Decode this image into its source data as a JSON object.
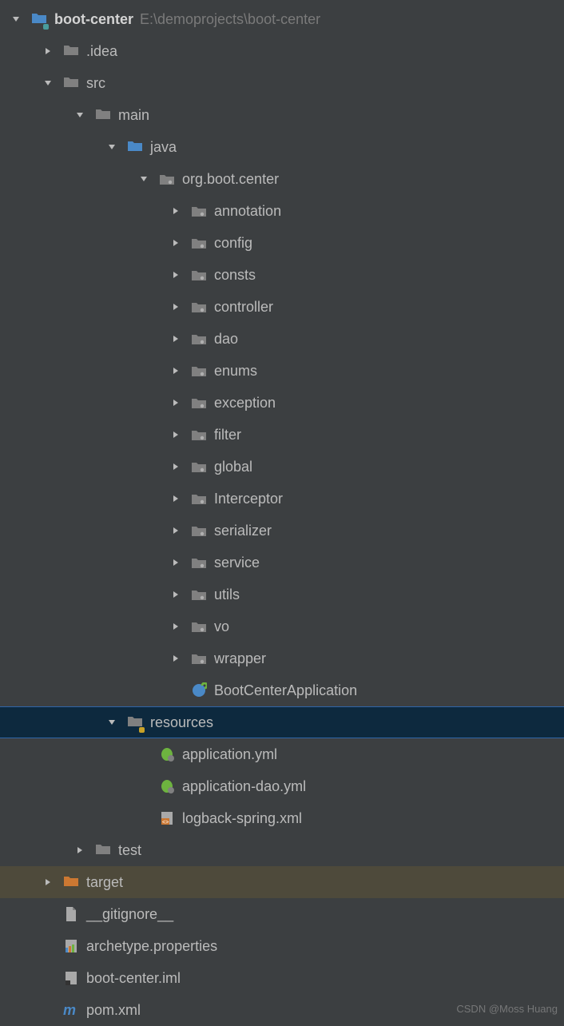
{
  "root": {
    "name": "boot-center",
    "path": "E:\\demoprojects\\boot-center"
  },
  "tree": [
    {
      "depth": 0,
      "expand": "open",
      "icon": "module-folder",
      "label": "boot-center",
      "bold": true,
      "aux": "E:\\demoprojects\\boot-center"
    },
    {
      "depth": 1,
      "expand": "closed",
      "icon": "folder",
      "label": ".idea"
    },
    {
      "depth": 1,
      "expand": "open",
      "icon": "folder",
      "label": "src"
    },
    {
      "depth": 2,
      "expand": "open",
      "icon": "folder",
      "label": "main"
    },
    {
      "depth": 3,
      "expand": "open",
      "icon": "folder-source",
      "label": "java"
    },
    {
      "depth": 4,
      "expand": "open",
      "icon": "package",
      "label": "org.boot.center"
    },
    {
      "depth": 5,
      "expand": "closed",
      "icon": "package",
      "label": "annotation"
    },
    {
      "depth": 5,
      "expand": "closed",
      "icon": "package",
      "label": "config"
    },
    {
      "depth": 5,
      "expand": "closed",
      "icon": "package",
      "label": "consts"
    },
    {
      "depth": 5,
      "expand": "closed",
      "icon": "package",
      "label": "controller"
    },
    {
      "depth": 5,
      "expand": "closed",
      "icon": "package",
      "label": "dao"
    },
    {
      "depth": 5,
      "expand": "closed",
      "icon": "package",
      "label": "enums"
    },
    {
      "depth": 5,
      "expand": "closed",
      "icon": "package",
      "label": "exception"
    },
    {
      "depth": 5,
      "expand": "closed",
      "icon": "package",
      "label": "filter"
    },
    {
      "depth": 5,
      "expand": "closed",
      "icon": "package",
      "label": "global"
    },
    {
      "depth": 5,
      "expand": "closed",
      "icon": "package",
      "label": "Interceptor"
    },
    {
      "depth": 5,
      "expand": "closed",
      "icon": "package",
      "label": "serializer"
    },
    {
      "depth": 5,
      "expand": "closed",
      "icon": "package",
      "label": "service"
    },
    {
      "depth": 5,
      "expand": "closed",
      "icon": "package",
      "label": "utils"
    },
    {
      "depth": 5,
      "expand": "closed",
      "icon": "package",
      "label": "vo"
    },
    {
      "depth": 5,
      "expand": "closed",
      "icon": "package",
      "label": "wrapper"
    },
    {
      "depth": 5,
      "expand": "none",
      "icon": "spring-run",
      "label": "BootCenterApplication"
    },
    {
      "depth": 3,
      "expand": "open",
      "icon": "folder-res",
      "label": "resources",
      "selected": true
    },
    {
      "depth": 4,
      "expand": "none",
      "icon": "spring-yml",
      "label": "application.yml"
    },
    {
      "depth": 4,
      "expand": "none",
      "icon": "spring-yml",
      "label": "application-dao.yml"
    },
    {
      "depth": 4,
      "expand": "none",
      "icon": "xml",
      "label": "logback-spring.xml"
    },
    {
      "depth": 2,
      "expand": "closed",
      "icon": "folder",
      "label": "test"
    },
    {
      "depth": 1,
      "expand": "closed",
      "icon": "folder-target",
      "label": "target",
      "highlight": true
    },
    {
      "depth": 1,
      "expand": "none",
      "icon": "file",
      "label": "__gitignore__"
    },
    {
      "depth": 1,
      "expand": "none",
      "icon": "props",
      "label": "archetype.properties"
    },
    {
      "depth": 1,
      "expand": "none",
      "icon": "iml",
      "label": "boot-center.iml"
    },
    {
      "depth": 1,
      "expand": "none",
      "icon": "maven",
      "label": "pom.xml"
    }
  ],
  "watermark": "CSDN @Moss Huang",
  "indent_unit": 40,
  "arrow_width": 20
}
